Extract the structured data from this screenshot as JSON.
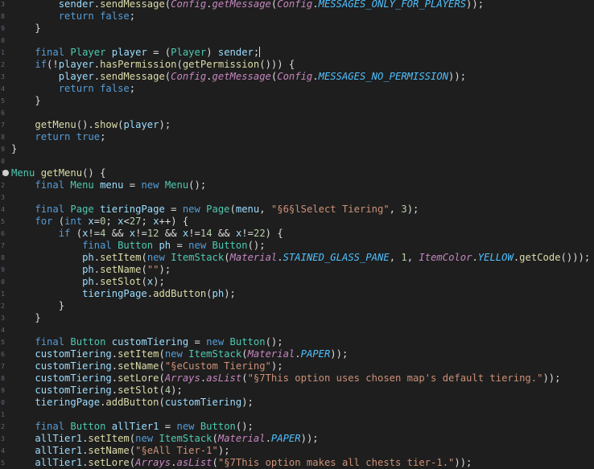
{
  "line_numbers": [
    "3",
    "8",
    "9",
    "0",
    "1",
    "2",
    "3",
    "4",
    "5",
    "6",
    "7",
    "8",
    "9",
    "0",
    "1",
    "2",
    "3",
    "4",
    "5",
    "6",
    "7",
    "8",
    "9",
    "0",
    "1",
    "2",
    "3",
    "4",
    "5",
    "6",
    "7",
    "8",
    "9",
    "0",
    "1",
    "2",
    "3",
    "4",
    "5"
  ],
  "lines": [
    [
      {
        "t": "        ",
        "c": "pl"
      },
      {
        "t": "sender",
        "c": "va"
      },
      {
        "t": ".",
        "c": "pl"
      },
      {
        "t": "sendMessage",
        "c": "me"
      },
      {
        "t": "(",
        "c": "pl"
      },
      {
        "t": "Config",
        "c": "cl"
      },
      {
        "t": ".",
        "c": "pl"
      },
      {
        "t": "getMessage",
        "c": "cl"
      },
      {
        "t": "(",
        "c": "pl"
      },
      {
        "t": "Config",
        "c": "cl"
      },
      {
        "t": ".",
        "c": "pl"
      },
      {
        "t": "MESSAGES_ONLY_FOR_PLAYERS",
        "c": "fi"
      },
      {
        "t": "));",
        "c": "pl"
      }
    ],
    [
      {
        "t": "        ",
        "c": "pl"
      },
      {
        "t": "return false",
        "c": "kw"
      },
      {
        "t": ";",
        "c": "pl"
      }
    ],
    [
      {
        "t": "    }",
        "c": "pl"
      }
    ],
    [
      {
        "t": "",
        "c": "pl"
      }
    ],
    [
      {
        "t": "    ",
        "c": "pl"
      },
      {
        "t": "final ",
        "c": "kw"
      },
      {
        "t": "Player ",
        "c": "ty"
      },
      {
        "t": "player",
        "c": "va"
      },
      {
        "t": " = (",
        "c": "pl"
      },
      {
        "t": "Player",
        "c": "ty"
      },
      {
        "t": ") ",
        "c": "pl"
      },
      {
        "t": "sender",
        "c": "va"
      },
      {
        "t": ";",
        "c": "pl"
      },
      {
        "t": "|cursor|",
        "c": "cursor"
      }
    ],
    [
      {
        "t": "    ",
        "c": "pl"
      },
      {
        "t": "if",
        "c": "kw"
      },
      {
        "t": "(!",
        "c": "pl"
      },
      {
        "t": "player",
        "c": "va"
      },
      {
        "t": ".",
        "c": "pl"
      },
      {
        "t": "hasPermission",
        "c": "me"
      },
      {
        "t": "(",
        "c": "pl"
      },
      {
        "t": "getPermission",
        "c": "me"
      },
      {
        "t": "())) {",
        "c": "pl"
      }
    ],
    [
      {
        "t": "        ",
        "c": "pl"
      },
      {
        "t": "player",
        "c": "va"
      },
      {
        "t": ".",
        "c": "pl"
      },
      {
        "t": "sendMessage",
        "c": "me"
      },
      {
        "t": "(",
        "c": "pl"
      },
      {
        "t": "Config",
        "c": "cl"
      },
      {
        "t": ".",
        "c": "pl"
      },
      {
        "t": "getMessage",
        "c": "cl"
      },
      {
        "t": "(",
        "c": "pl"
      },
      {
        "t": "Config",
        "c": "cl"
      },
      {
        "t": ".",
        "c": "pl"
      },
      {
        "t": "MESSAGES_NO_PERMISSION",
        "c": "fi"
      },
      {
        "t": "));",
        "c": "pl"
      }
    ],
    [
      {
        "t": "        ",
        "c": "pl"
      },
      {
        "t": "return false",
        "c": "kw"
      },
      {
        "t": ";",
        "c": "pl"
      }
    ],
    [
      {
        "t": "    }",
        "c": "pl"
      }
    ],
    [
      {
        "t": "",
        "c": "pl"
      }
    ],
    [
      {
        "t": "    ",
        "c": "pl"
      },
      {
        "t": "getMenu",
        "c": "me"
      },
      {
        "t": "().",
        "c": "pl"
      },
      {
        "t": "show",
        "c": "me"
      },
      {
        "t": "(",
        "c": "pl"
      },
      {
        "t": "player",
        "c": "va"
      },
      {
        "t": ");",
        "c": "pl"
      }
    ],
    [
      {
        "t": "    ",
        "c": "pl"
      },
      {
        "t": "return true",
        "c": "kw"
      },
      {
        "t": ";",
        "c": "pl"
      }
    ],
    [
      {
        "t": "}",
        "c": "pl"
      }
    ],
    [
      {
        "t": "",
        "c": "pl"
      }
    ],
    [
      {
        "t": "Menu ",
        "c": "ty"
      },
      {
        "t": "getMenu",
        "c": "me"
      },
      {
        "t": "() {",
        "c": "pl"
      }
    ],
    [
      {
        "t": "    ",
        "c": "pl"
      },
      {
        "t": "final ",
        "c": "kw"
      },
      {
        "t": "Menu ",
        "c": "ty"
      },
      {
        "t": "menu",
        "c": "va"
      },
      {
        "t": " = ",
        "c": "pl"
      },
      {
        "t": "new ",
        "c": "kw"
      },
      {
        "t": "Menu",
        "c": "ty"
      },
      {
        "t": "();",
        "c": "pl"
      }
    ],
    [
      {
        "t": "",
        "c": "pl"
      }
    ],
    [
      {
        "t": "    ",
        "c": "pl"
      },
      {
        "t": "final ",
        "c": "kw"
      },
      {
        "t": "Page ",
        "c": "ty"
      },
      {
        "t": "tieringPage",
        "c": "va"
      },
      {
        "t": " = ",
        "c": "pl"
      },
      {
        "t": "new ",
        "c": "kw"
      },
      {
        "t": "Page",
        "c": "ty"
      },
      {
        "t": "(",
        "c": "pl"
      },
      {
        "t": "menu",
        "c": "va"
      },
      {
        "t": ", ",
        "c": "pl"
      },
      {
        "t": "\"§6§lSelect Tiering\"",
        "c": "st"
      },
      {
        "t": ", ",
        "c": "pl"
      },
      {
        "t": "3",
        "c": "nu"
      },
      {
        "t": ");",
        "c": "pl"
      }
    ],
    [
      {
        "t": "    ",
        "c": "pl"
      },
      {
        "t": "for ",
        "c": "kw"
      },
      {
        "t": "(",
        "c": "pl"
      },
      {
        "t": "int ",
        "c": "kw"
      },
      {
        "t": "x",
        "c": "va"
      },
      {
        "t": "=",
        "c": "pl"
      },
      {
        "t": "0",
        "c": "nu"
      },
      {
        "t": "; ",
        "c": "pl"
      },
      {
        "t": "x",
        "c": "va"
      },
      {
        "t": "<",
        "c": "pl"
      },
      {
        "t": "27",
        "c": "nu"
      },
      {
        "t": "; ",
        "c": "pl"
      },
      {
        "t": "x",
        "c": "va"
      },
      {
        "t": "++) {",
        "c": "pl"
      }
    ],
    [
      {
        "t": "        ",
        "c": "pl"
      },
      {
        "t": "if ",
        "c": "kw"
      },
      {
        "t": "(",
        "c": "pl"
      },
      {
        "t": "x",
        "c": "va"
      },
      {
        "t": "!=",
        "c": "pl"
      },
      {
        "t": "4",
        "c": "nu"
      },
      {
        "t": " && ",
        "c": "pl"
      },
      {
        "t": "x",
        "c": "va"
      },
      {
        "t": "!=",
        "c": "pl"
      },
      {
        "t": "12",
        "c": "nu"
      },
      {
        "t": " && ",
        "c": "pl"
      },
      {
        "t": "x",
        "c": "va"
      },
      {
        "t": "!=",
        "c": "pl"
      },
      {
        "t": "14",
        "c": "nu"
      },
      {
        "t": " && ",
        "c": "pl"
      },
      {
        "t": "x",
        "c": "va"
      },
      {
        "t": "!=",
        "c": "pl"
      },
      {
        "t": "22",
        "c": "nu"
      },
      {
        "t": ") {",
        "c": "pl"
      }
    ],
    [
      {
        "t": "            ",
        "c": "pl"
      },
      {
        "t": "final ",
        "c": "kw"
      },
      {
        "t": "Button ",
        "c": "ty"
      },
      {
        "t": "ph",
        "c": "va"
      },
      {
        "t": " = ",
        "c": "pl"
      },
      {
        "t": "new ",
        "c": "kw"
      },
      {
        "t": "Button",
        "c": "ty"
      },
      {
        "t": "();",
        "c": "pl"
      }
    ],
    [
      {
        "t": "            ",
        "c": "pl"
      },
      {
        "t": "ph",
        "c": "va"
      },
      {
        "t": ".",
        "c": "pl"
      },
      {
        "t": "setItem",
        "c": "me"
      },
      {
        "t": "(",
        "c": "pl"
      },
      {
        "t": "new ",
        "c": "kw"
      },
      {
        "t": "ItemStack",
        "c": "ty"
      },
      {
        "t": "(",
        "c": "pl"
      },
      {
        "t": "Material",
        "c": "cl"
      },
      {
        "t": ".",
        "c": "pl"
      },
      {
        "t": "STAINED_GLASS_PANE",
        "c": "fi"
      },
      {
        "t": ", ",
        "c": "pl"
      },
      {
        "t": "1",
        "c": "nu"
      },
      {
        "t": ", ",
        "c": "pl"
      },
      {
        "t": "ItemColor",
        "c": "cl"
      },
      {
        "t": ".",
        "c": "pl"
      },
      {
        "t": "YELLOW",
        "c": "fi"
      },
      {
        "t": ".",
        "c": "pl"
      },
      {
        "t": "getCode",
        "c": "me"
      },
      {
        "t": "()));",
        "c": "pl"
      }
    ],
    [
      {
        "t": "            ",
        "c": "pl"
      },
      {
        "t": "ph",
        "c": "va"
      },
      {
        "t": ".",
        "c": "pl"
      },
      {
        "t": "setName",
        "c": "me"
      },
      {
        "t": "(",
        "c": "pl"
      },
      {
        "t": "\"\"",
        "c": "st"
      },
      {
        "t": ");",
        "c": "pl"
      }
    ],
    [
      {
        "t": "            ",
        "c": "pl"
      },
      {
        "t": "ph",
        "c": "va"
      },
      {
        "t": ".",
        "c": "pl"
      },
      {
        "t": "setSlot",
        "c": "me"
      },
      {
        "t": "(",
        "c": "pl"
      },
      {
        "t": "x",
        "c": "va"
      },
      {
        "t": ");",
        "c": "pl"
      }
    ],
    [
      {
        "t": "            ",
        "c": "pl"
      },
      {
        "t": "tieringPage",
        "c": "va"
      },
      {
        "t": ".",
        "c": "pl"
      },
      {
        "t": "addButton",
        "c": "me"
      },
      {
        "t": "(",
        "c": "pl"
      },
      {
        "t": "ph",
        "c": "va"
      },
      {
        "t": ");",
        "c": "pl"
      }
    ],
    [
      {
        "t": "        }",
        "c": "pl"
      }
    ],
    [
      {
        "t": "    }",
        "c": "pl"
      }
    ],
    [
      {
        "t": "",
        "c": "pl"
      }
    ],
    [
      {
        "t": "    ",
        "c": "pl"
      },
      {
        "t": "final ",
        "c": "kw"
      },
      {
        "t": "Button ",
        "c": "ty"
      },
      {
        "t": "customTiering",
        "c": "va"
      },
      {
        "t": " = ",
        "c": "pl"
      },
      {
        "t": "new ",
        "c": "kw"
      },
      {
        "t": "Button",
        "c": "ty"
      },
      {
        "t": "();",
        "c": "pl"
      }
    ],
    [
      {
        "t": "    ",
        "c": "pl"
      },
      {
        "t": "customTiering",
        "c": "va"
      },
      {
        "t": ".",
        "c": "pl"
      },
      {
        "t": "setItem",
        "c": "me"
      },
      {
        "t": "(",
        "c": "pl"
      },
      {
        "t": "new ",
        "c": "kw"
      },
      {
        "t": "ItemStack",
        "c": "ty"
      },
      {
        "t": "(",
        "c": "pl"
      },
      {
        "t": "Material",
        "c": "cl"
      },
      {
        "t": ".",
        "c": "pl"
      },
      {
        "t": "PAPER",
        "c": "fi"
      },
      {
        "t": "));",
        "c": "pl"
      }
    ],
    [
      {
        "t": "    ",
        "c": "pl"
      },
      {
        "t": "customTiering",
        "c": "va"
      },
      {
        "t": ".",
        "c": "pl"
      },
      {
        "t": "setName",
        "c": "me"
      },
      {
        "t": "(",
        "c": "pl"
      },
      {
        "t": "\"§eCustom Tiering\"",
        "c": "st"
      },
      {
        "t": ");",
        "c": "pl"
      }
    ],
    [
      {
        "t": "    ",
        "c": "pl"
      },
      {
        "t": "customTiering",
        "c": "va"
      },
      {
        "t": ".",
        "c": "pl"
      },
      {
        "t": "setLore",
        "c": "me"
      },
      {
        "t": "(",
        "c": "pl"
      },
      {
        "t": "Arrays",
        "c": "cl"
      },
      {
        "t": ".",
        "c": "pl"
      },
      {
        "t": "asList",
        "c": "cl"
      },
      {
        "t": "(",
        "c": "pl"
      },
      {
        "t": "\"§7This option uses chosen map's default tiering.\"",
        "c": "st"
      },
      {
        "t": "));",
        "c": "pl"
      }
    ],
    [
      {
        "t": "    ",
        "c": "pl"
      },
      {
        "t": "customTiering",
        "c": "va"
      },
      {
        "t": ".",
        "c": "pl"
      },
      {
        "t": "setSlot",
        "c": "me"
      },
      {
        "t": "(",
        "c": "pl"
      },
      {
        "t": "4",
        "c": "nu"
      },
      {
        "t": ");",
        "c": "pl"
      }
    ],
    [
      {
        "t": "    ",
        "c": "pl"
      },
      {
        "t": "tieringPage",
        "c": "va"
      },
      {
        "t": ".",
        "c": "pl"
      },
      {
        "t": "addButton",
        "c": "me"
      },
      {
        "t": "(",
        "c": "pl"
      },
      {
        "t": "customTiering",
        "c": "va"
      },
      {
        "t": ");",
        "c": "pl"
      }
    ],
    [
      {
        "t": "",
        "c": "pl"
      }
    ],
    [
      {
        "t": "    ",
        "c": "pl"
      },
      {
        "t": "final ",
        "c": "kw"
      },
      {
        "t": "Button ",
        "c": "ty"
      },
      {
        "t": "allTier1",
        "c": "va"
      },
      {
        "t": " = ",
        "c": "pl"
      },
      {
        "t": "new ",
        "c": "kw"
      },
      {
        "t": "Button",
        "c": "ty"
      },
      {
        "t": "();",
        "c": "pl"
      }
    ],
    [
      {
        "t": "    ",
        "c": "pl"
      },
      {
        "t": "allTier1",
        "c": "va"
      },
      {
        "t": ".",
        "c": "pl"
      },
      {
        "t": "setItem",
        "c": "me"
      },
      {
        "t": "(",
        "c": "pl"
      },
      {
        "t": "new ",
        "c": "kw"
      },
      {
        "t": "ItemStack",
        "c": "ty"
      },
      {
        "t": "(",
        "c": "pl"
      },
      {
        "t": "Material",
        "c": "cl"
      },
      {
        "t": ".",
        "c": "pl"
      },
      {
        "t": "PAPER",
        "c": "fi"
      },
      {
        "t": "));",
        "c": "pl"
      }
    ],
    [
      {
        "t": "    ",
        "c": "pl"
      },
      {
        "t": "allTier1",
        "c": "va"
      },
      {
        "t": ".",
        "c": "pl"
      },
      {
        "t": "setName",
        "c": "me"
      },
      {
        "t": "(",
        "c": "pl"
      },
      {
        "t": "\"§eAll Tier-1\"",
        "c": "st"
      },
      {
        "t": ");",
        "c": "pl"
      }
    ],
    [
      {
        "t": "    ",
        "c": "pl"
      },
      {
        "t": "allTier1",
        "c": "va"
      },
      {
        "t": ".",
        "c": "pl"
      },
      {
        "t": "setLore",
        "c": "me"
      },
      {
        "t": "(",
        "c": "pl"
      },
      {
        "t": "Arrays",
        "c": "cl"
      },
      {
        "t": ".",
        "c": "pl"
      },
      {
        "t": "asList",
        "c": "cl"
      },
      {
        "t": "(",
        "c": "pl"
      },
      {
        "t": "\"§7This option makes all chests tier-1.\"",
        "c": "st"
      },
      {
        "t": "));",
        "c": "pl"
      }
    ]
  ],
  "fold_marker_line": 14,
  "colors": {
    "background": "#1e1e1e",
    "keyword": "#569cd6",
    "type": "#4ec9b0",
    "variable": "#9cdcfe",
    "method": "#dcdcaa",
    "string": "#ce9178",
    "number": "#b5cea8",
    "static_class": "#c586c0",
    "field": "#4fc1ff"
  }
}
